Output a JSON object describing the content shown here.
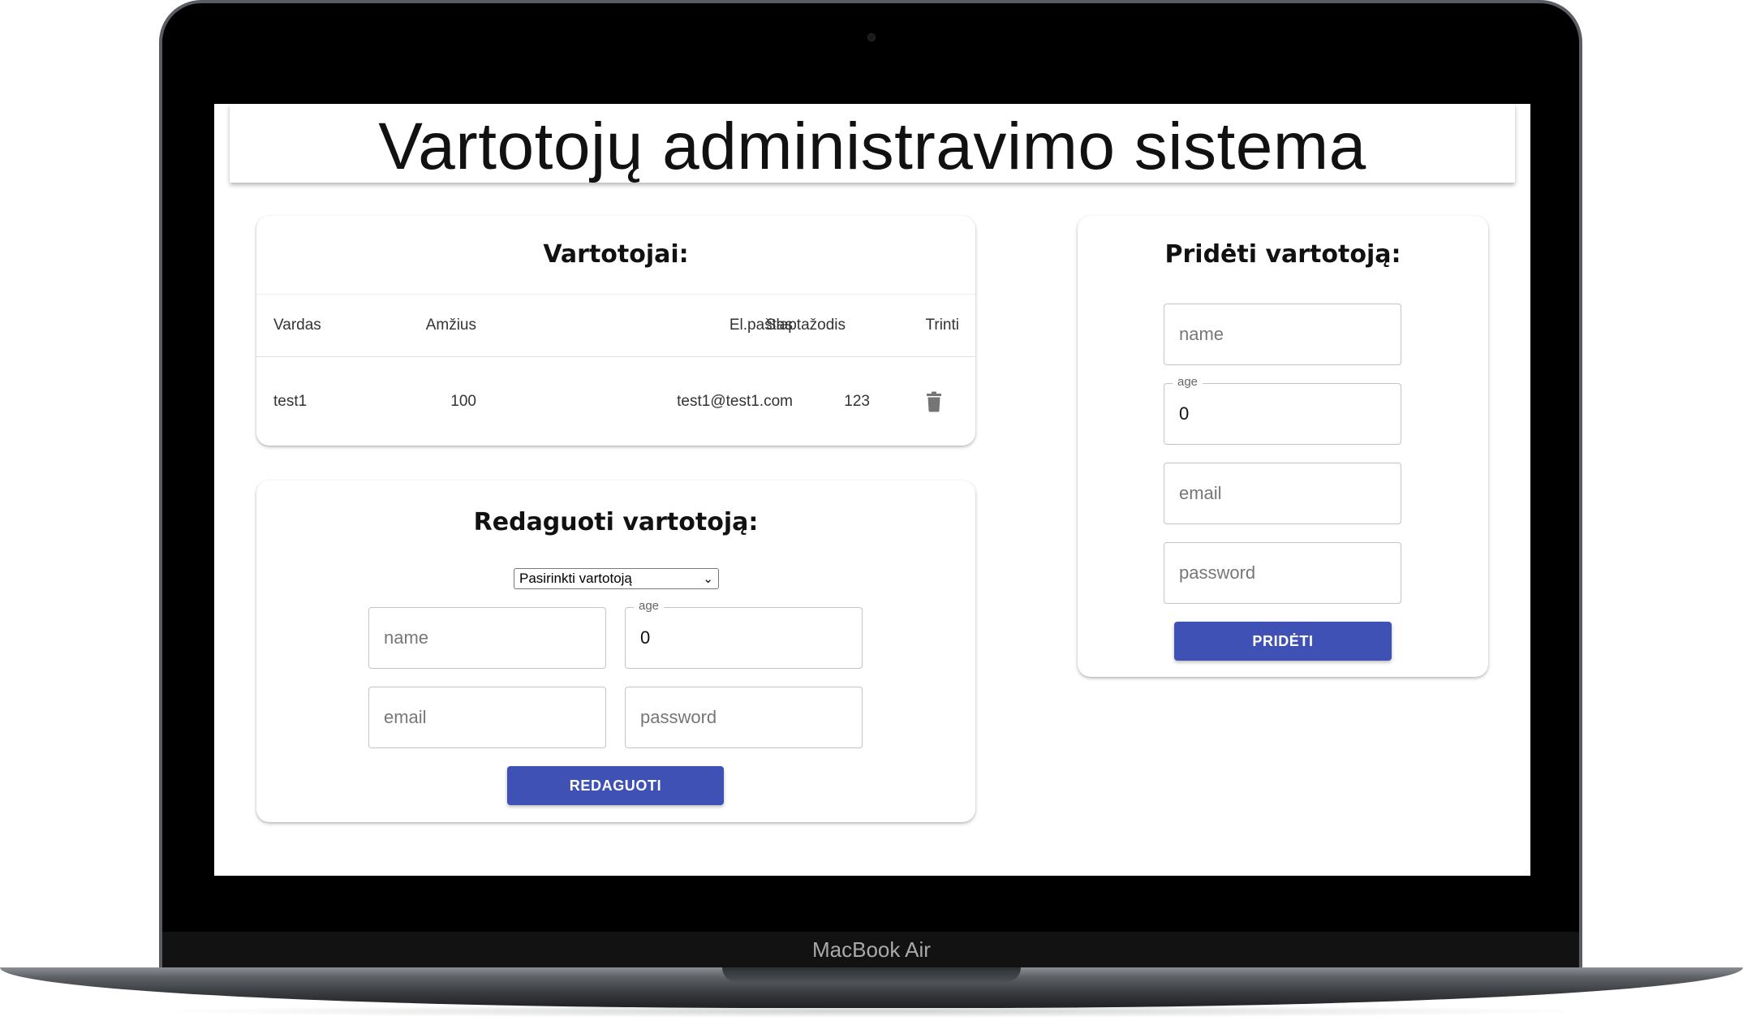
{
  "device": {
    "label": "MacBook Air"
  },
  "app": {
    "title": "Vartotojų administravimo sistema"
  },
  "users_table": {
    "title": "Vartotojai:",
    "columns": [
      "Vardas",
      "Amžius",
      "El.paštas",
      "Slaptažodis",
      "Trinti"
    ],
    "rows": [
      {
        "name": "test1",
        "age": "100",
        "email": "test1@test1.com",
        "password": "123",
        "delete_icon": "trash-icon"
      }
    ]
  },
  "edit_form": {
    "title": "Redaguoti vartotoją:",
    "select": {
      "selected": "Pasirinkti vartotoją",
      "icon": "chevron-down-icon"
    },
    "name": {
      "placeholder": "name"
    },
    "age": {
      "label": "age",
      "value": "0"
    },
    "email": {
      "placeholder": "email"
    },
    "password": {
      "placeholder": "password"
    },
    "submit_label": "REDAGUOTI"
  },
  "add_form": {
    "title": "Pridėti vartotoją:",
    "name": {
      "placeholder": "name"
    },
    "age": {
      "label": "age",
      "value": "0"
    },
    "email": {
      "placeholder": "email"
    },
    "password": {
      "placeholder": "password"
    },
    "submit_label": "PRIDĖTI"
  },
  "colors": {
    "primary_button": "#3f51b5",
    "trash_icon": "#757575",
    "laptop_bezel": "#000000"
  }
}
